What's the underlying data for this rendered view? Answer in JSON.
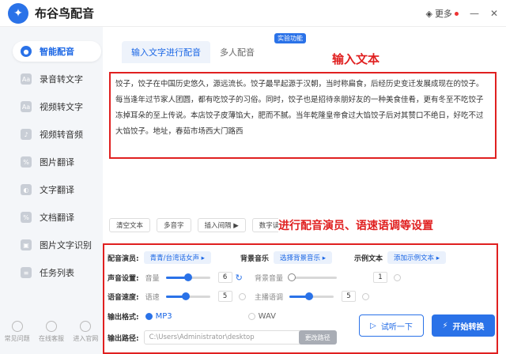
{
  "app": {
    "title": "布谷鸟配音",
    "more_label": "更多"
  },
  "sidebar": {
    "items": [
      {
        "label": "智能配音",
        "icon": "microphone-icon"
      },
      {
        "label": "录音转文字",
        "icon": "record-icon"
      },
      {
        "label": "视频转文字",
        "icon": "video-icon"
      },
      {
        "label": "视频转音频",
        "icon": "audio-icon"
      },
      {
        "label": "图片翻译",
        "icon": "image-icon"
      },
      {
        "label": "文字翻译",
        "icon": "translate-icon"
      },
      {
        "label": "文档翻译",
        "icon": "document-icon"
      },
      {
        "label": "图片文字识别",
        "icon": "ocr-icon"
      },
      {
        "label": "任务列表",
        "icon": "list-icon"
      }
    ],
    "bottom": [
      {
        "label": "常见问题"
      },
      {
        "label": "在线客服"
      },
      {
        "label": "进入官网"
      }
    ]
  },
  "main": {
    "tabs": [
      {
        "label": "输入文字进行配音"
      },
      {
        "label": "多人配音"
      }
    ],
    "badge": "实验功能",
    "annotation_input": "输入文本",
    "annotation_settings": "进行配音演员、语速语调等设置",
    "text_content": "饺子，饺子在中国历史悠久，源远流长。饺子最早起源于汉朝，当时称扁食，后经历史变迁发展成现在的饺子。每当逢年过节家人团圆，都有吃饺子的习俗。同时，饺子也是招待亲朋好友的一种美食佳肴，更有冬至不吃饺子冻掉耳朵的至上传说。本店饺子皮薄馅大，肥而不腻。当年乾隆皇帝食过大馅饺子后对其赞口不绝日，好吃不过大馅饺子。地址，春茹市场西大门路西",
    "toolbar": {
      "clear": "清空文本",
      "polyphone": "多音字",
      "insert_pause": "插入间隔 ▶",
      "number_read": "数字读法"
    }
  },
  "settings": {
    "voice_label": "配音演员:",
    "voice_value": "青青/台湾话女声",
    "bgm_label": "背景音乐",
    "bgm_value": "选择背景音乐",
    "sample_label": "示例文本",
    "sample_value": "添加示例文本",
    "volume_label": "声音设置:",
    "volume_sub": "音量",
    "volume_value": "6",
    "volume_level": 0.5,
    "bg_volume_sub": "背景音量",
    "bg_volume_value": "1",
    "bg_volume_level": 0.05,
    "speed_label": "语音速度:",
    "speed_sub": "语速",
    "speed_value": "5",
    "speed_level": 0.45,
    "pitch_sub": "主播语调",
    "pitch_value": "5",
    "pitch_level": 0.45,
    "format_label": "输出格式:",
    "format_mp3": "MP3",
    "format_wav": "WAV",
    "path_label": "输出路径:",
    "path_value": "C:\\Users\\Administrator\\desktop",
    "change_path": "更改路径",
    "listen_button": "试听一下",
    "start_button": "开始转换"
  },
  "colors": {
    "accent": "#2a72e8",
    "annotation": "#e02020"
  }
}
